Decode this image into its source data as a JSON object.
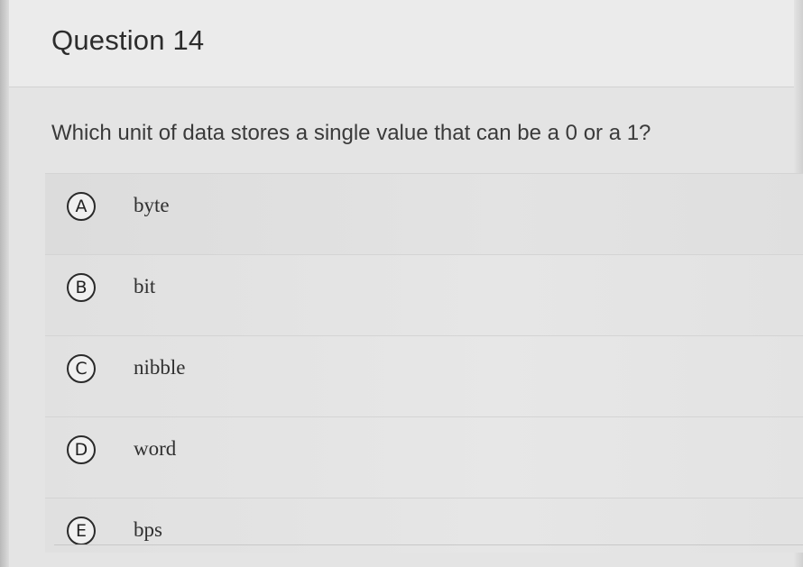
{
  "question": {
    "title": "Question 14",
    "prompt": "Which unit of data stores a single value that can be a 0 or a 1?"
  },
  "options": [
    {
      "letter": "A",
      "text": "byte"
    },
    {
      "letter": "B",
      "text": "bit"
    },
    {
      "letter": "C",
      "text": "nibble"
    },
    {
      "letter": "D",
      "text": "word"
    },
    {
      "letter": "E",
      "text": "bps"
    }
  ]
}
